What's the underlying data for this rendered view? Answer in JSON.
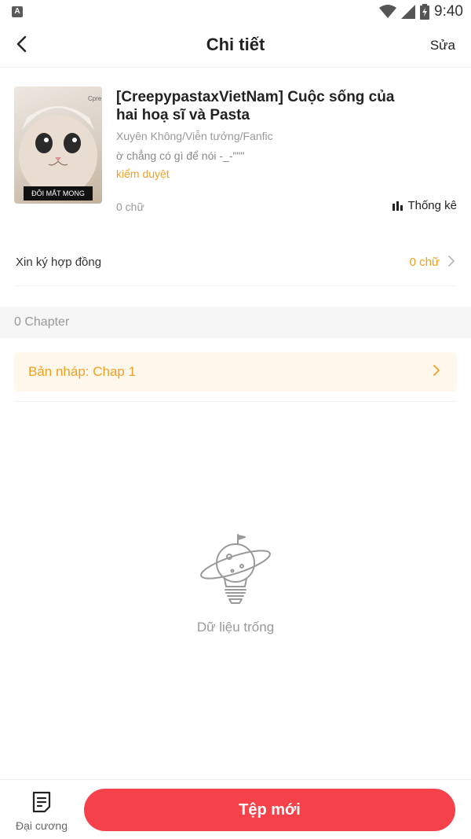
{
  "status_bar": {
    "time": "9:40",
    "app_icon": "A",
    "icons": [
      "wifi-icon",
      "signal-icon",
      "battery-icon"
    ]
  },
  "header": {
    "title": "Chi tiết",
    "edit_label": "Sửa",
    "back_icon": "chevron-left-icon"
  },
  "book": {
    "title": "[CreepypastaxVietNam] Cuộc sống của hai hoạ sĩ và Pasta",
    "cover_caption": "ĐÔI MẮT MONG CHỜ!",
    "genre": "Xuyên Không/Viễn tưởng/Fanfic",
    "description": "ờ chẳng có gì để nói -_-\"\"\"",
    "status": "kiểm duyệt",
    "word_count": "0 chữ",
    "stats_label": "Thống kê"
  },
  "contract": {
    "label": "Xin ký hợp đồng",
    "value": "0 chữ"
  },
  "chapters": {
    "count_label": "0 Chapter"
  },
  "draft": {
    "label": "Bản nháp: Chap 1"
  },
  "empty_state": {
    "text": "Dữ liệu trống",
    "icon": "planet-bulb-icon"
  },
  "bottom_bar": {
    "outline_label": "Đại cương",
    "new_button_label": "Tệp mới"
  },
  "colors": {
    "accent_orange": "#f0a020",
    "primary_red": "#f5424a",
    "draft_bg": "#fdf7ec"
  }
}
